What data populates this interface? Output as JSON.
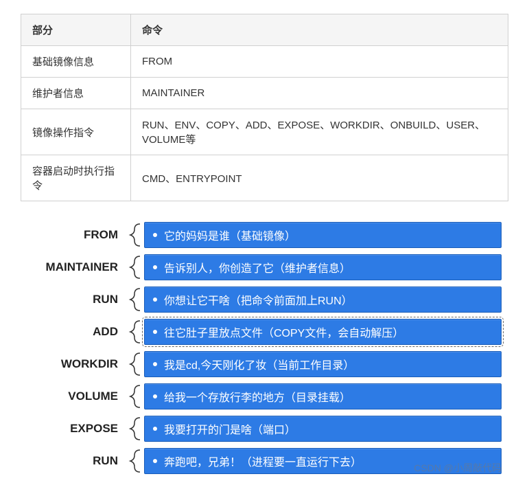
{
  "table": {
    "headers": [
      "部分",
      "命令"
    ],
    "rows": [
      {
        "part": "基础镜像信息",
        "cmd": "FROM"
      },
      {
        "part": "维护者信息",
        "cmd": "MAINTAINER"
      },
      {
        "part": "镜像操作指令",
        "cmd": "RUN、ENV、COPY、ADD、EXPOSE、WORKDIR、ONBUILD、USER、VOLUME等"
      },
      {
        "part": "容器启动时执行指令",
        "cmd": "CMD、ENTRYPOINT"
      }
    ]
  },
  "diagram": {
    "items": [
      {
        "label": "FROM",
        "desc": "它的妈妈是谁（基础镜像）",
        "dashed": false
      },
      {
        "label": "MAINTAINER",
        "desc": "告诉别人，你创造了它（维护者信息）",
        "dashed": false
      },
      {
        "label": "RUN",
        "desc": "你想让它干啥（把命令前面加上RUN）",
        "dashed": false
      },
      {
        "label": "ADD",
        "desc": "往它肚子里放点文件（COPY文件，会自动解压）",
        "dashed": true
      },
      {
        "label": "WORKDIR",
        "desc": "我是cd,今天刚化了妆（当前工作目录）",
        "dashed": false
      },
      {
        "label": "VOLUME",
        "desc": "给我一个存放行李的地方（目录挂载）",
        "dashed": false
      },
      {
        "label": "EXPOSE",
        "desc": "我要打开的门是啥（端口）",
        "dashed": false
      },
      {
        "label": "RUN",
        "desc": "奔跑吧，兄弟！（进程要一直运行下去）",
        "dashed": false
      }
    ]
  },
  "watermark": "CSDN @小周敲代码"
}
